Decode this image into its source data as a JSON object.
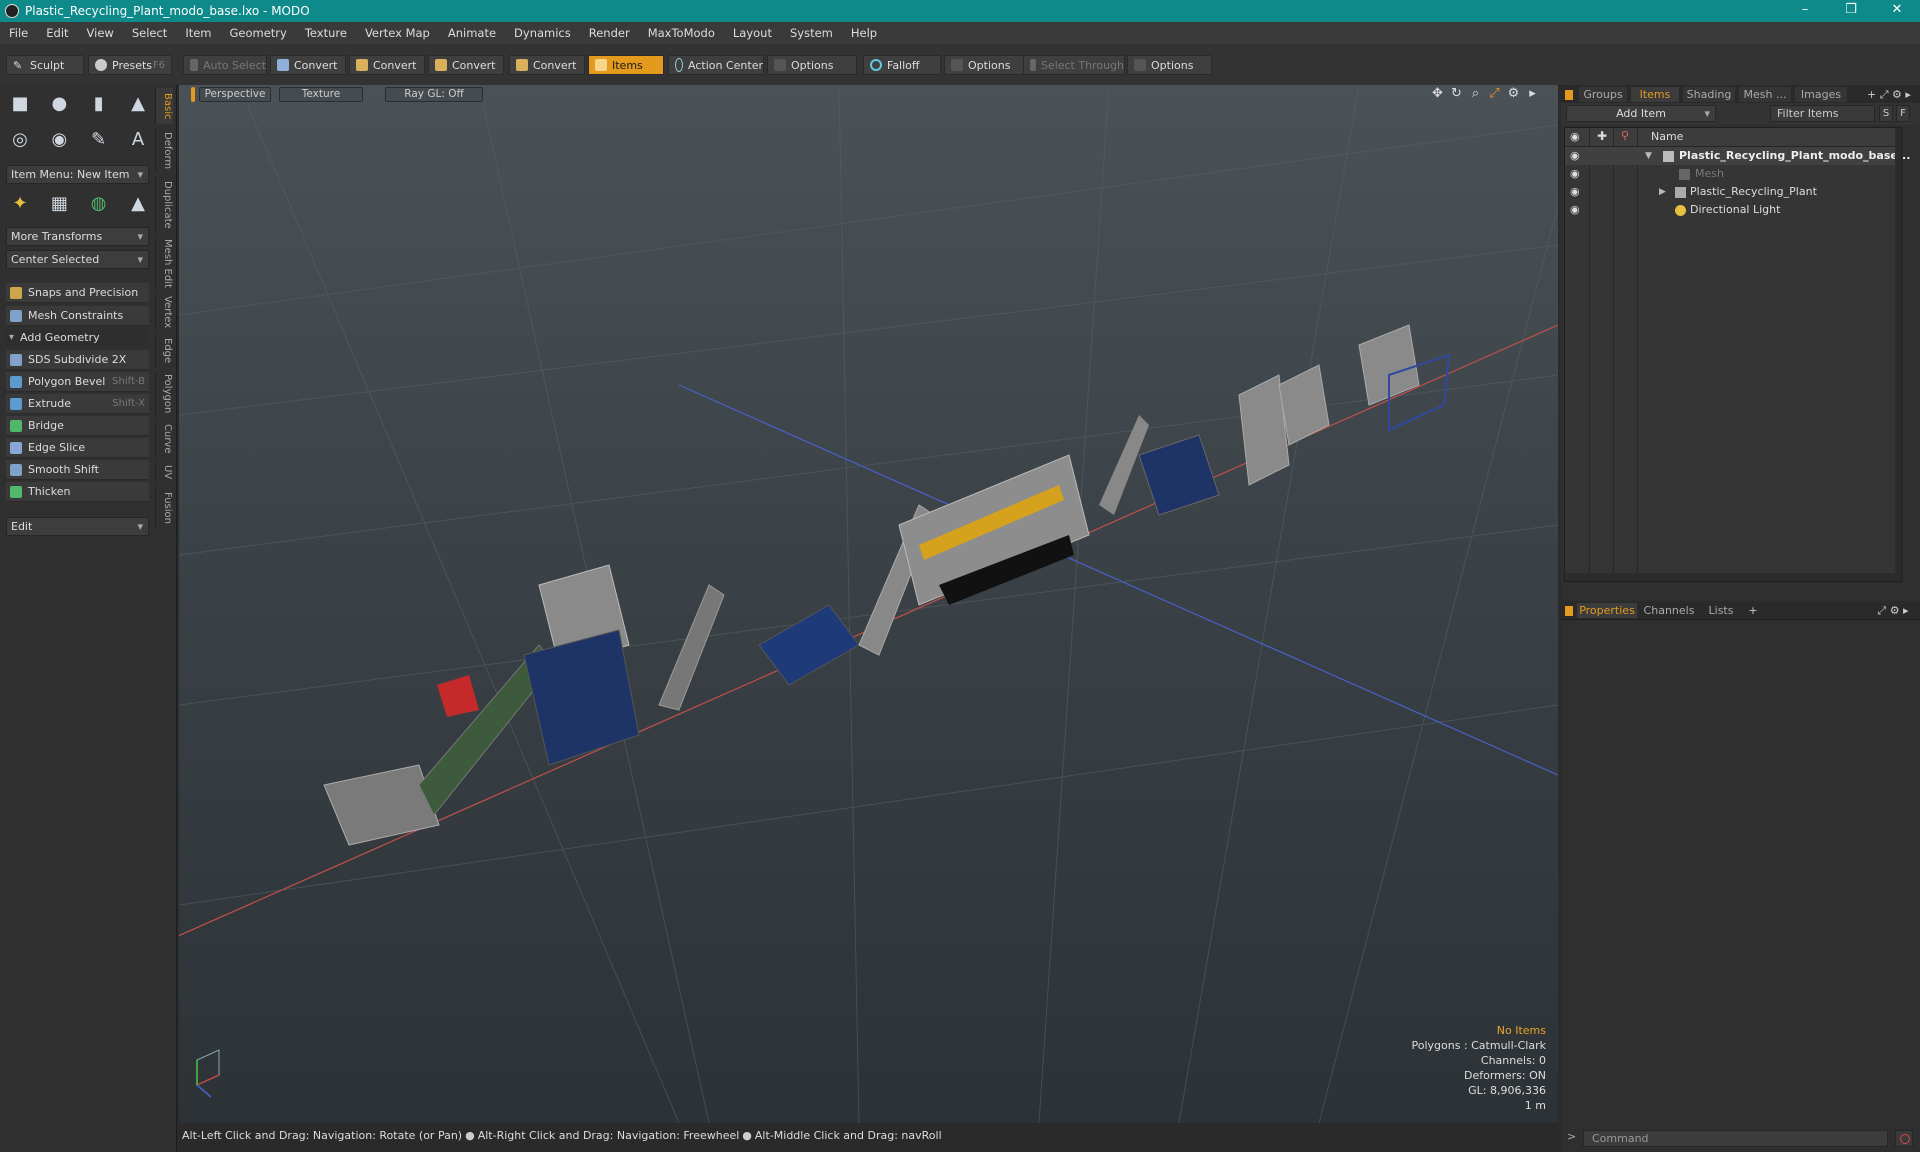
{
  "window": {
    "title": "Plastic_Recycling_Plant_modo_base.lxo - MODO",
    "controls": [
      "–",
      "❐",
      "✕"
    ]
  },
  "menu": [
    "File",
    "Edit",
    "View",
    "Select",
    "Item",
    "Geometry",
    "Texture",
    "Vertex Map",
    "Animate",
    "Dynamics",
    "Render",
    "MaxToModo",
    "Layout",
    "System",
    "Help"
  ],
  "toolbar": {
    "sculpt": "Sculpt",
    "presets": "Presets",
    "presets_key": "F6",
    "auto_select": "Auto Select",
    "convert": "Convert",
    "items": "Items",
    "action_center": "Action Center",
    "options": "Options",
    "falloff": "Falloff",
    "select_through": "Select Through"
  },
  "left": {
    "item_menu": "Item Menu: New Item",
    "more_transforms": "More Transforms",
    "center_selected": "Center Selected",
    "snaps": "Snaps and Precision",
    "mesh_constraints": "Mesh Constraints",
    "add_geometry": "Add Geometry",
    "tools": [
      {
        "label": "SDS Subdivide 2X",
        "key": "",
        "color": "#7fa2c8"
      },
      {
        "label": "Polygon Bevel",
        "key": "Shift-B",
        "color": "#5c9bd1"
      },
      {
        "label": "Extrude",
        "key": "Shift-X",
        "color": "#5c9bd1"
      },
      {
        "label": "Bridge",
        "key": "",
        "color": "#4fb86b"
      },
      {
        "label": "Edge Slice",
        "key": "",
        "color": "#8aa6d6"
      },
      {
        "label": "Smooth Shift",
        "key": "",
        "color": "#7fa2c8"
      },
      {
        "label": "Thicken",
        "key": "",
        "color": "#4fb86b"
      }
    ],
    "edit": "Edit",
    "vtabs": [
      "Basic",
      "Deform",
      "Duplicate",
      "Mesh Edit",
      "Vertex",
      "Edge",
      "Polygon",
      "Curve",
      "UV",
      "Fusion"
    ]
  },
  "viewport": {
    "view": "Perspective",
    "shading": "Texture",
    "raygl": "Ray GL: Off",
    "stats": {
      "selection": "No Items",
      "polygons": "Polygons : Catmull-Clark",
      "channels": "Channels: 0",
      "deformers": "Deformers: ON",
      "gl": "GL: 8,906,336",
      "scale": "1 m"
    }
  },
  "status": {
    "hint1": "Alt-Left Click and Drag: Navigation: Rotate (or Pan)",
    "hint2": "Alt-Right Click and Drag: Navigation: Freewheel",
    "hint3": "Alt-Middle Click and Drag: navRoll"
  },
  "right": {
    "tabs": [
      "Groups",
      "Items",
      "Shading",
      "Mesh ...",
      "Images"
    ],
    "add_item": "Add Item",
    "filter": "Filter Items",
    "s": "S",
    "f": "F",
    "col_name": "Name",
    "tree": [
      {
        "label": "Plastic_Recycling_Plant_modo_base...",
        "bold": true
      },
      {
        "label": "Mesh",
        "dim": true
      },
      {
        "label": "Plastic_Recycling_Plant"
      },
      {
        "label": "Directional Light"
      }
    ],
    "ptabs": [
      "Properties",
      "Channels",
      "Lists"
    ],
    "command": "Command"
  }
}
